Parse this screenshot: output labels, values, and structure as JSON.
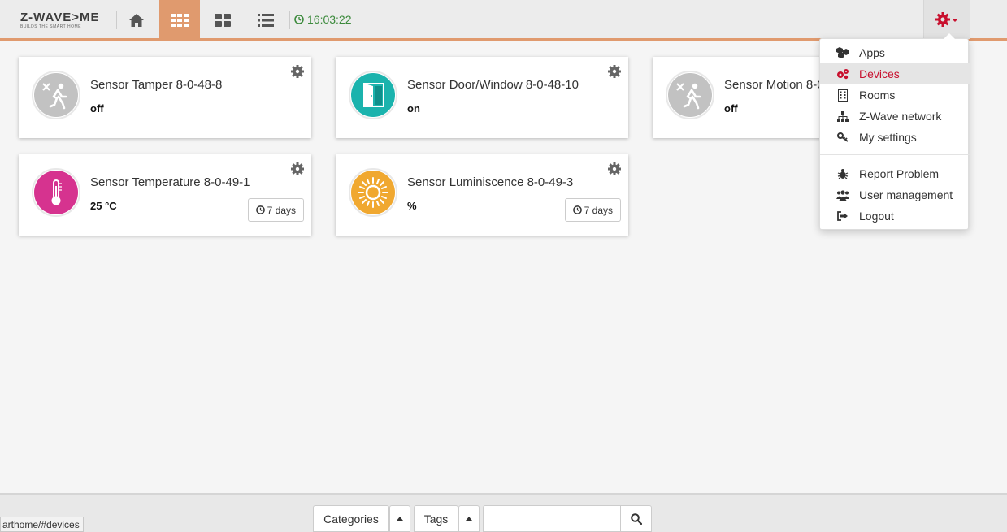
{
  "navbar": {
    "logo_text": "Z-WAVE>ME",
    "logo_tagline": "BUILDS THE SMART HOME",
    "clock": "16:03:22",
    "home_icon": "home-icon",
    "elements_icon": "grid-icon",
    "dashboard_icon": "dashboard-icon",
    "list_icon": "list-icon",
    "settings_icon": "gear-icon"
  },
  "colors": {
    "accent": "#e09a6e",
    "menu_active": "#c8102e",
    "clock": "#3c8a3c",
    "door_icon": "#1bb3ad",
    "temperature_icon": "#d6338f",
    "luminiscence_icon": "#f0a830",
    "inactive_icon": "#c2c2c2"
  },
  "devices": [
    {
      "title": "Sensor Tamper 8-0-48-8",
      "level": "off",
      "icon": "motion-off-icon"
    },
    {
      "title": "Sensor Door/Window 8-0-48-10",
      "level": "on",
      "icon": "door-open-icon"
    },
    {
      "title": "Sensor Motion 8-0",
      "level": "off",
      "icon": "motion-off-icon"
    },
    {
      "title": "Sensor Temperature 8-0-49-1",
      "level": "25 °C",
      "icon": "thermometer-icon",
      "history": "7 days"
    },
    {
      "title": "Sensor Luminiscence 8-0-49-3",
      "level": "%",
      "icon": "sun-icon",
      "history": "7 days"
    }
  ],
  "menu": {
    "items": [
      {
        "label": "Apps",
        "icon": "apps-icon"
      },
      {
        "label": "Devices",
        "icon": "devices-icon",
        "active": true
      },
      {
        "label": "Rooms",
        "icon": "building-icon"
      },
      {
        "label": "Z-Wave network",
        "icon": "network-icon"
      },
      {
        "label": "My settings",
        "icon": "key-icon"
      },
      {
        "label": "Report Problem",
        "icon": "bug-icon"
      },
      {
        "label": "User management",
        "icon": "users-icon"
      },
      {
        "label": "Logout",
        "icon": "logout-icon"
      }
    ]
  },
  "footer": {
    "categories_label": "Categories",
    "tags_label": "Tags",
    "search_value": "",
    "search_icon": "search-icon"
  },
  "status_url": "arthome/#devices"
}
